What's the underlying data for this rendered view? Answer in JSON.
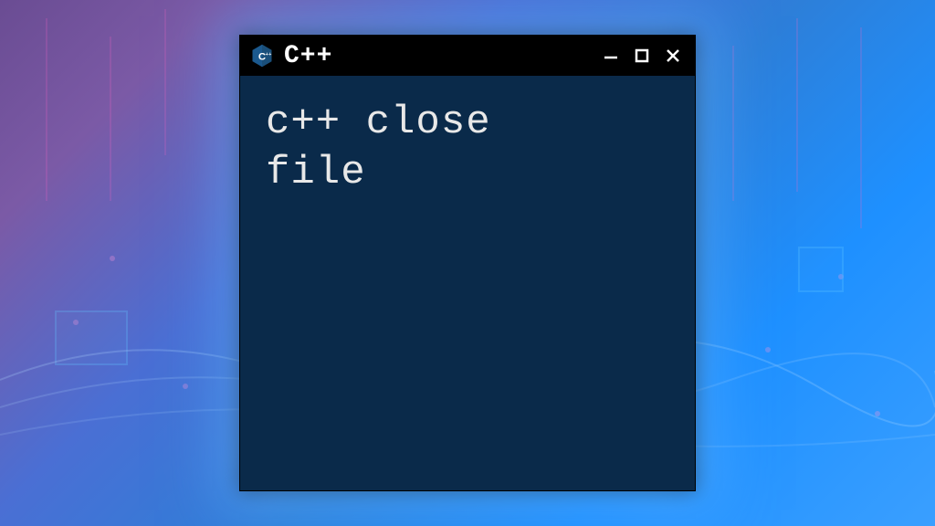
{
  "window": {
    "title": "C++",
    "icon_label": "C++"
  },
  "content": {
    "line1": "c++ close",
    "line2": "file"
  },
  "colors": {
    "window_bg": "#0a2a4a",
    "titlebar_bg": "#000000",
    "text": "#e8e8e8"
  }
}
